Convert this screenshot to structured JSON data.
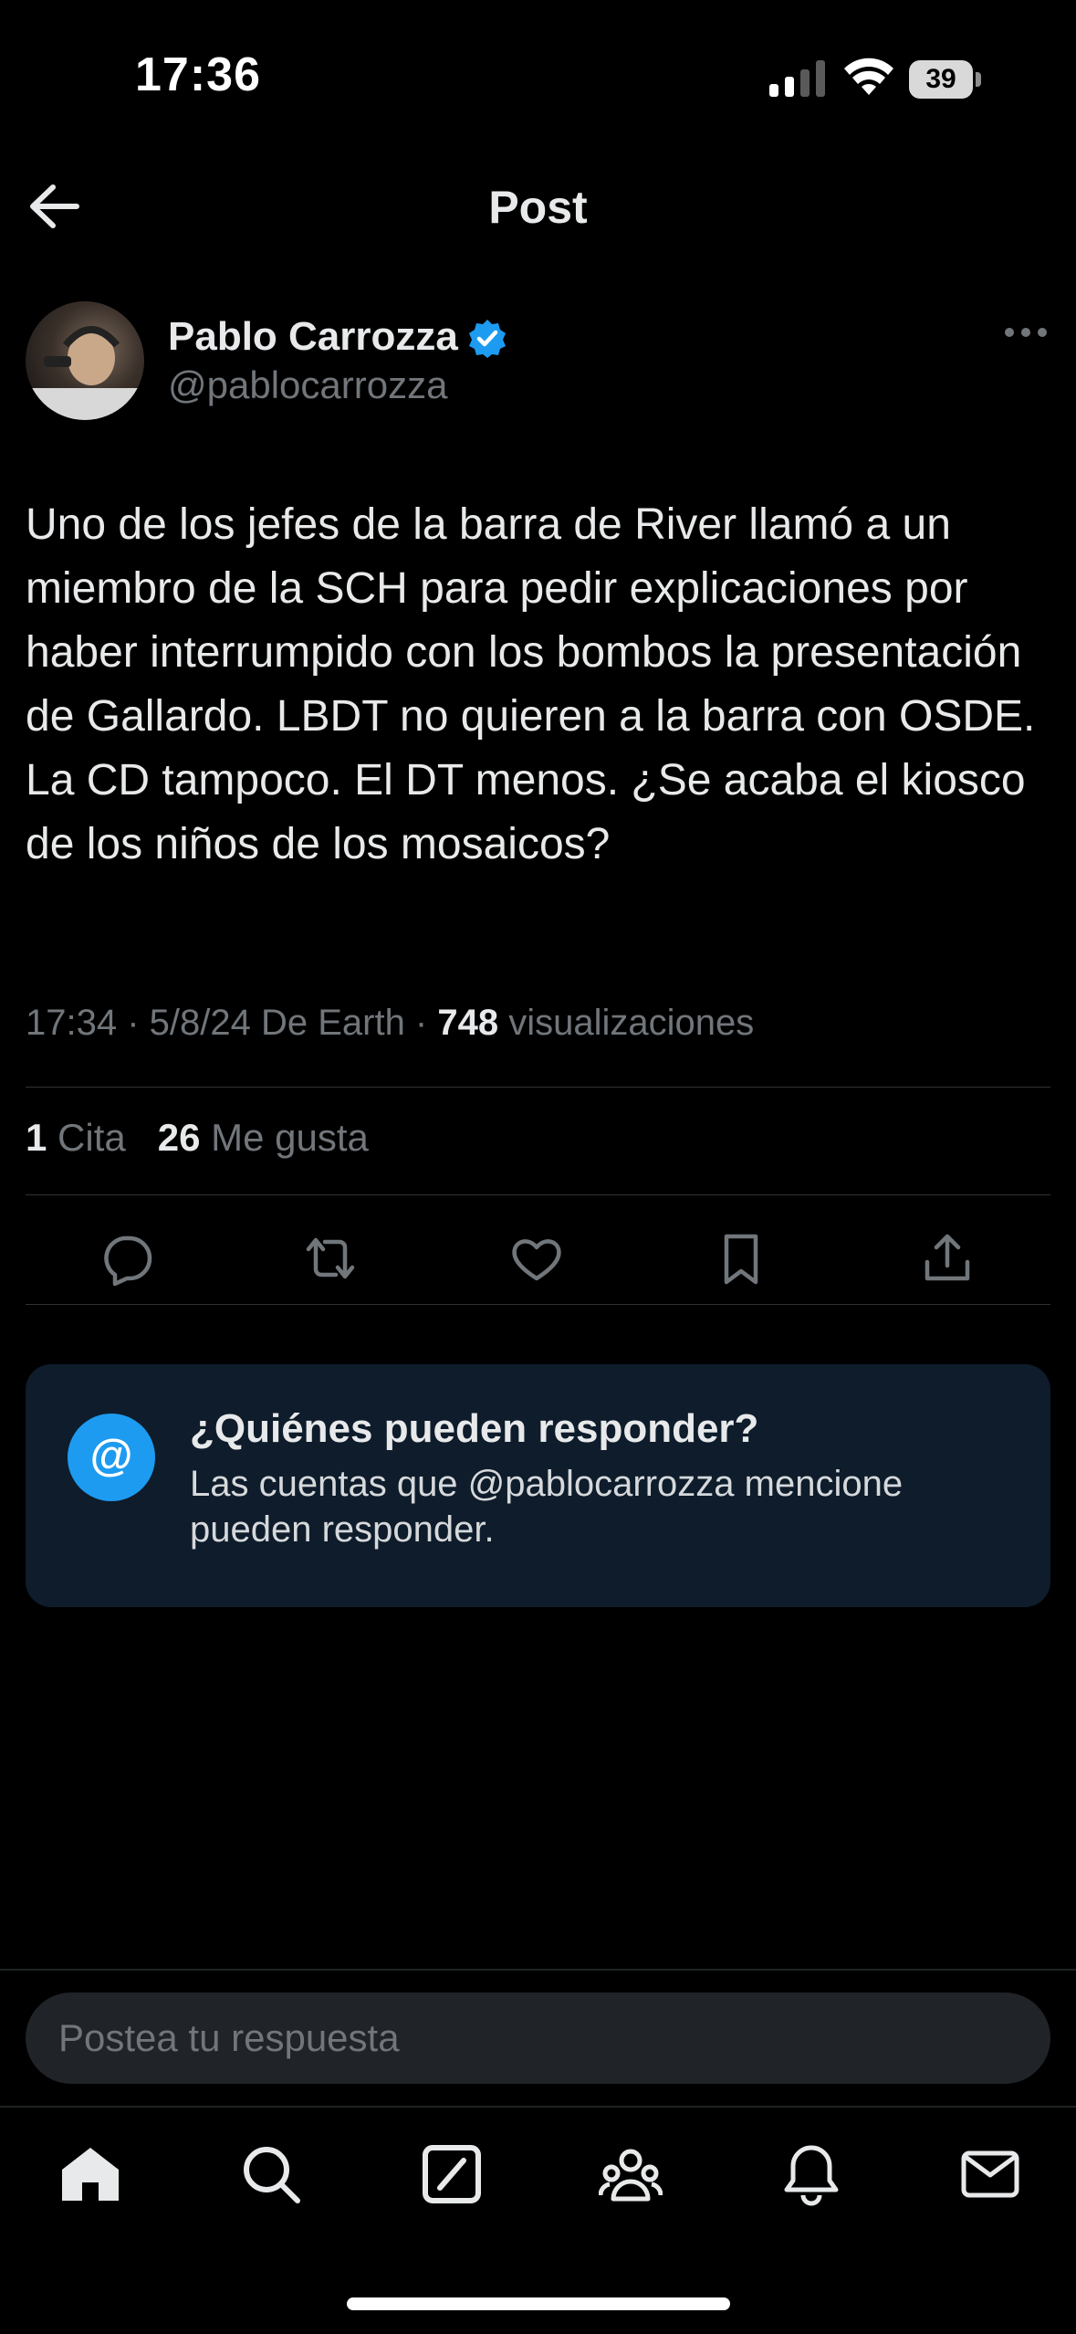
{
  "status_bar": {
    "time": "17:36",
    "battery": "39"
  },
  "header": {
    "title": "Post"
  },
  "author": {
    "display_name": "Pablo Carrozza",
    "handle": "@pablocarrozza"
  },
  "tweet": {
    "text": "Uno de los jefes de la barra de River llamó a un miembro de la SCH para pedir explicaciones por haber interrumpido con los bombos la presentación de Gallardo. LBDT no quieren a la barra con OSDE. La CD tampoco. El DT menos. ¿Se acaba el kiosco de los niños de los mosaicos?",
    "meta_prefix": "17:34 · 5/8/24 De Earth · ",
    "views_count": "748",
    "views_label": " visualizaciones",
    "quotes_count": "1",
    "quotes_label": " Cita",
    "likes_count": "26",
    "likes_label": " Me gusta"
  },
  "reply_restriction": {
    "icon": "@",
    "title": "¿Quiénes pueden responder?",
    "text": "Las cuentas que @pablocarrozza mencione pueden responder."
  },
  "reply_bar": {
    "placeholder": "Postea tu respuesta"
  },
  "colors": {
    "accent": "#1d9bf0",
    "card_bg": "#0e1c2b",
    "muted": "#71767b"
  },
  "icons": {
    "actions": [
      "reply-icon",
      "repost-icon",
      "like-icon",
      "bookmark-icon",
      "share-icon"
    ],
    "nav": [
      "home-icon",
      "search-icon",
      "grok-icon",
      "communities-icon",
      "notifications-icon",
      "messages-icon"
    ]
  }
}
